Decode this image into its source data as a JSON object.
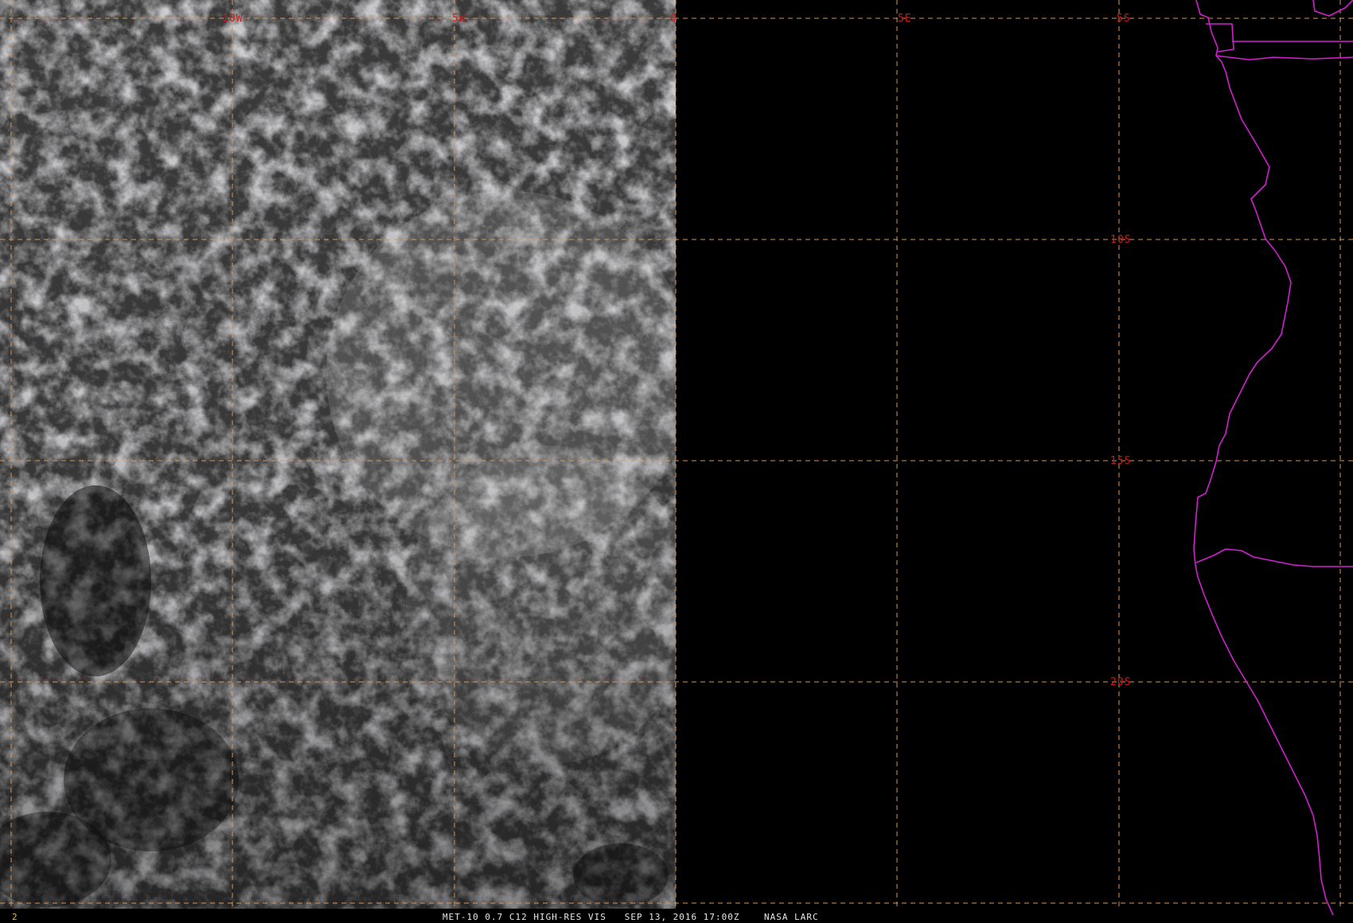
{
  "product": {
    "satellite": "MET-10",
    "channel": "0.7 C12 HIGH-RES VIS",
    "datetime": "SEP 13, 2016 17:00Z",
    "source": "NASA LARC",
    "frame_number": "2"
  },
  "grid": {
    "longitude_labels": [
      "10W",
      "5W",
      "0",
      "5E"
    ],
    "latitude_labels": [
      "5S",
      "10S",
      "15S",
      "20S"
    ],
    "line_color": "#d8965a",
    "label_color": "#d01818"
  },
  "map_layers": {
    "imagery": "visible satellite cloud imagery (daylight side only)",
    "night_region": "black (no data east of 0)",
    "borders_color": "#d020d0",
    "borders": "Africa west coastline and national boundaries"
  }
}
